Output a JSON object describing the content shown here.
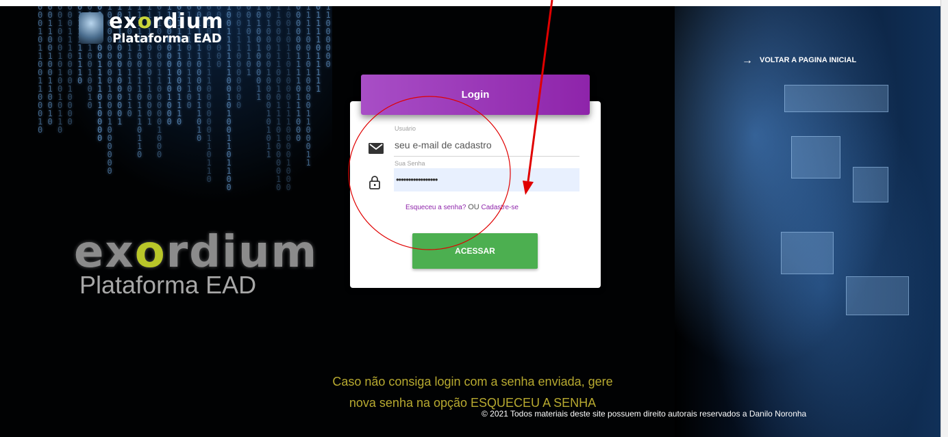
{
  "brand": {
    "name_left": "ex",
    "name_o": "o",
    "name_right": "rdium",
    "subtitle_small": "Plataforma EAD",
    "subtitle_big": "Plataforma EAD"
  },
  "header": {
    "back_link": "VOLTAR A PAGINA INICIAL",
    "back_icon": "arrow-right-icon"
  },
  "login": {
    "title": "Login",
    "user_label": "Usuário",
    "user_value": "seu e-mail de cadastro",
    "user_icon": "mail-icon",
    "password_label": "Sua Senha",
    "password_value": "•••••••••••••••••",
    "password_icon": "lock-icon",
    "forgot_link": "Esqueceu a senha?",
    "or_text": "OU",
    "register_link": "Cadastre-se",
    "submit": "ACESSAR"
  },
  "notice": {
    "line1": "Caso não consiga login com a senha enviada, gere",
    "line2": "nova senha na opção ESQUECEU A SENHA"
  },
  "footer": {
    "copyright": "© 2021 Todos materiais deste site possuem direito autorais reservados a Danilo Noronha"
  },
  "colors": {
    "accent": "#8e24aa",
    "button": "#4caf50",
    "notice_text": "#b8aa30",
    "annotation": "#e00000"
  }
}
